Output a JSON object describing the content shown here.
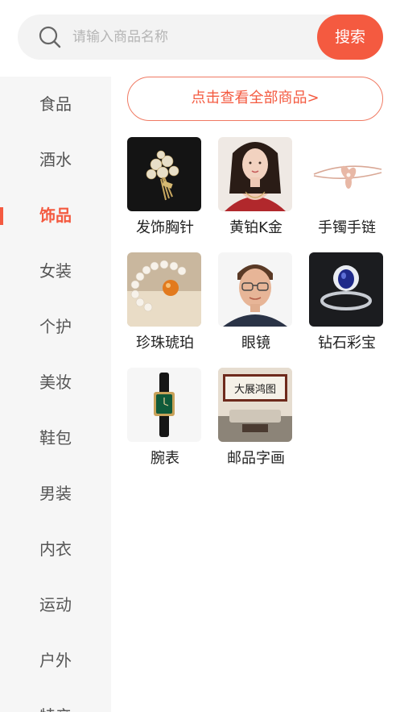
{
  "search": {
    "placeholder": "请输入商品名称",
    "button_label": "搜索"
  },
  "sidebar": {
    "items": [
      {
        "label": "食品"
      },
      {
        "label": "酒水"
      },
      {
        "label": "饰品",
        "active": true
      },
      {
        "label": "女装"
      },
      {
        "label": "个护"
      },
      {
        "label": "美妆"
      },
      {
        "label": "鞋包"
      },
      {
        "label": "男装"
      },
      {
        "label": "内衣"
      },
      {
        "label": "运动"
      },
      {
        "label": "户外"
      },
      {
        "label": "特产"
      }
    ]
  },
  "main": {
    "all_products_label": "点击查看全部商品>",
    "products": [
      {
        "label": "发饰胸针"
      },
      {
        "label": "黄铂K金"
      },
      {
        "label": "手镯手链"
      },
      {
        "label": "珍珠琥珀"
      },
      {
        "label": "眼镜"
      },
      {
        "label": "钻石彩宝"
      },
      {
        "label": "腕表"
      },
      {
        "label": "邮品字画",
        "painting_text": "大展鸿图"
      }
    ]
  },
  "colors": {
    "accent": "#f45a40",
    "sidebar_bg": "#f6f6f6",
    "search_bg": "#f3f3f3"
  }
}
